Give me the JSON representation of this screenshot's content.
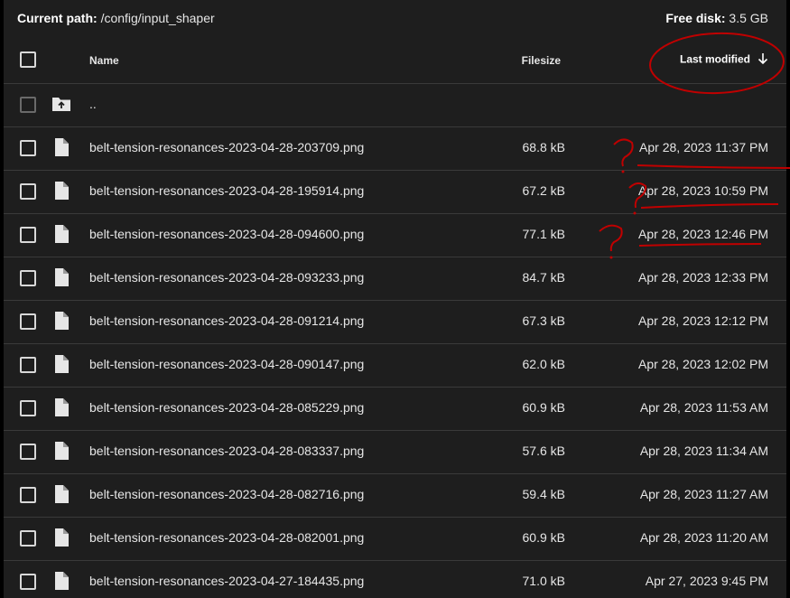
{
  "path_bar": {
    "current_path_label": "Current path:",
    "current_path_value": "/config/input_shaper",
    "free_disk_label": "Free disk:",
    "free_disk_value": "3.5 GB"
  },
  "table": {
    "headers": {
      "name": "Name",
      "filesize": "Filesize",
      "last_modified": "Last modified"
    },
    "parent_dir_label": "..",
    "rows": [
      {
        "name": "belt-tension-resonances-2023-04-28-203709.png",
        "size": "68.8 kB",
        "date": "Apr 28, 2023 11:37 PM"
      },
      {
        "name": "belt-tension-resonances-2023-04-28-195914.png",
        "size": "67.2 kB",
        "date": "Apr 28, 2023 10:59 PM"
      },
      {
        "name": "belt-tension-resonances-2023-04-28-094600.png",
        "size": "77.1 kB",
        "date": "Apr 28, 2023 12:46 PM"
      },
      {
        "name": "belt-tension-resonances-2023-04-28-093233.png",
        "size": "84.7 kB",
        "date": "Apr 28, 2023 12:33 PM"
      },
      {
        "name": "belt-tension-resonances-2023-04-28-091214.png",
        "size": "67.3 kB",
        "date": "Apr 28, 2023 12:12 PM"
      },
      {
        "name": "belt-tension-resonances-2023-04-28-090147.png",
        "size": "62.0 kB",
        "date": "Apr 28, 2023 12:02 PM"
      },
      {
        "name": "belt-tension-resonances-2023-04-28-085229.png",
        "size": "60.9 kB",
        "date": "Apr 28, 2023 11:53 AM"
      },
      {
        "name": "belt-tension-resonances-2023-04-28-083337.png",
        "size": "57.6 kB",
        "date": "Apr 28, 2023 11:34 AM"
      },
      {
        "name": "belt-tension-resonances-2023-04-28-082716.png",
        "size": "59.4 kB",
        "date": "Apr 28, 2023 11:27 AM"
      },
      {
        "name": "belt-tension-resonances-2023-04-28-082001.png",
        "size": "60.9 kB",
        "date": "Apr 28, 2023 11:20 AM"
      },
      {
        "name": "belt-tension-resonances-2023-04-27-184435.png",
        "size": "71.0 kB",
        "date": "Apr 27, 2023 9:45 PM"
      }
    ]
  },
  "colors": {
    "background": "#1e1e1e",
    "text": "#e6e6e6",
    "annotation": "#c00000"
  },
  "icons": {
    "sort": "arrow-down-icon",
    "parent_folder": "folder-up-icon",
    "file": "file-icon"
  }
}
